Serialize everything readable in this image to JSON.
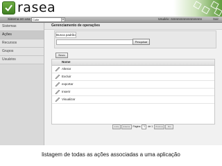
{
  "app": {
    "name": "rasea"
  },
  "topbar": {
    "system_label": "Sistema em uso:",
    "system_value": "Cutie",
    "user_label": "Usuário: nnnnnnnnnnnnnnnnnn",
    "exit_label": "Sair"
  },
  "sidebar": {
    "items": [
      {
        "label": "Sistemas"
      },
      {
        "label": "Ações"
      },
      {
        "label": "Recursos"
      },
      {
        "label": "Grupos"
      },
      {
        "label": "Usuários"
      }
    ]
  },
  "main": {
    "title": "Gerenciamento de operações",
    "search": {
      "title": "Busca padrão",
      "placeholder": "",
      "button": "Pesquisar"
    },
    "new_button": "Novo",
    "table": {
      "column": "Nome",
      "rows": [
        {
          "name": "Alterar"
        },
        {
          "name": "Excluir"
        },
        {
          "name": "exportar"
        },
        {
          "name": "Inserir"
        },
        {
          "name": "Visualizar"
        }
      ]
    },
    "pager": {
      "first": "Início",
      "prev": "Anterior",
      "page_label": "Página",
      "current": "1",
      "of_label": "de 1",
      "next": "Próximo",
      "last": "Fim"
    }
  },
  "caption": "listagem de todas as ações associadas a uma aplicação",
  "colors": {
    "brand_green": "#4f8f2f",
    "panel_bg": "#f1f1f1"
  }
}
